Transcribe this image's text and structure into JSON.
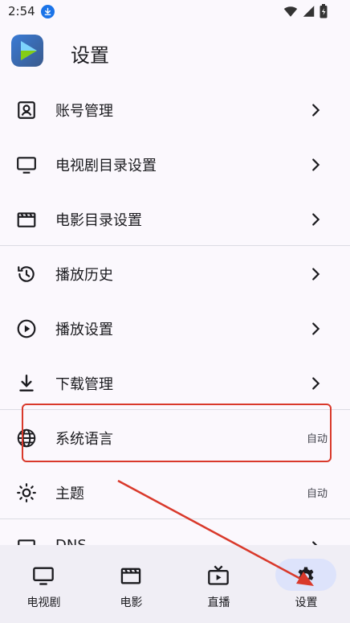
{
  "status": {
    "time": "2:54"
  },
  "header": {
    "title": "设置"
  },
  "settings": {
    "account": {
      "label": "账号管理"
    },
    "tv_dir": {
      "label": "电视剧目录设置"
    },
    "movie_dir": {
      "label": "电影目录设置"
    },
    "history": {
      "label": "播放历史"
    },
    "playback": {
      "label": "播放设置"
    },
    "downloads": {
      "label": "下载管理"
    },
    "language": {
      "label": "系统语言",
      "value": "自动"
    },
    "theme": {
      "label": "主题",
      "value": "自动"
    },
    "dns": {
      "label": "DNS"
    }
  },
  "nav": {
    "tv": "电视剧",
    "movie": "电影",
    "live": "直播",
    "settings": "设置",
    "active": "settings"
  },
  "colors": {
    "accent": "#dde3fb",
    "annotation": "#d9392b",
    "background": "#fbf8fd"
  }
}
